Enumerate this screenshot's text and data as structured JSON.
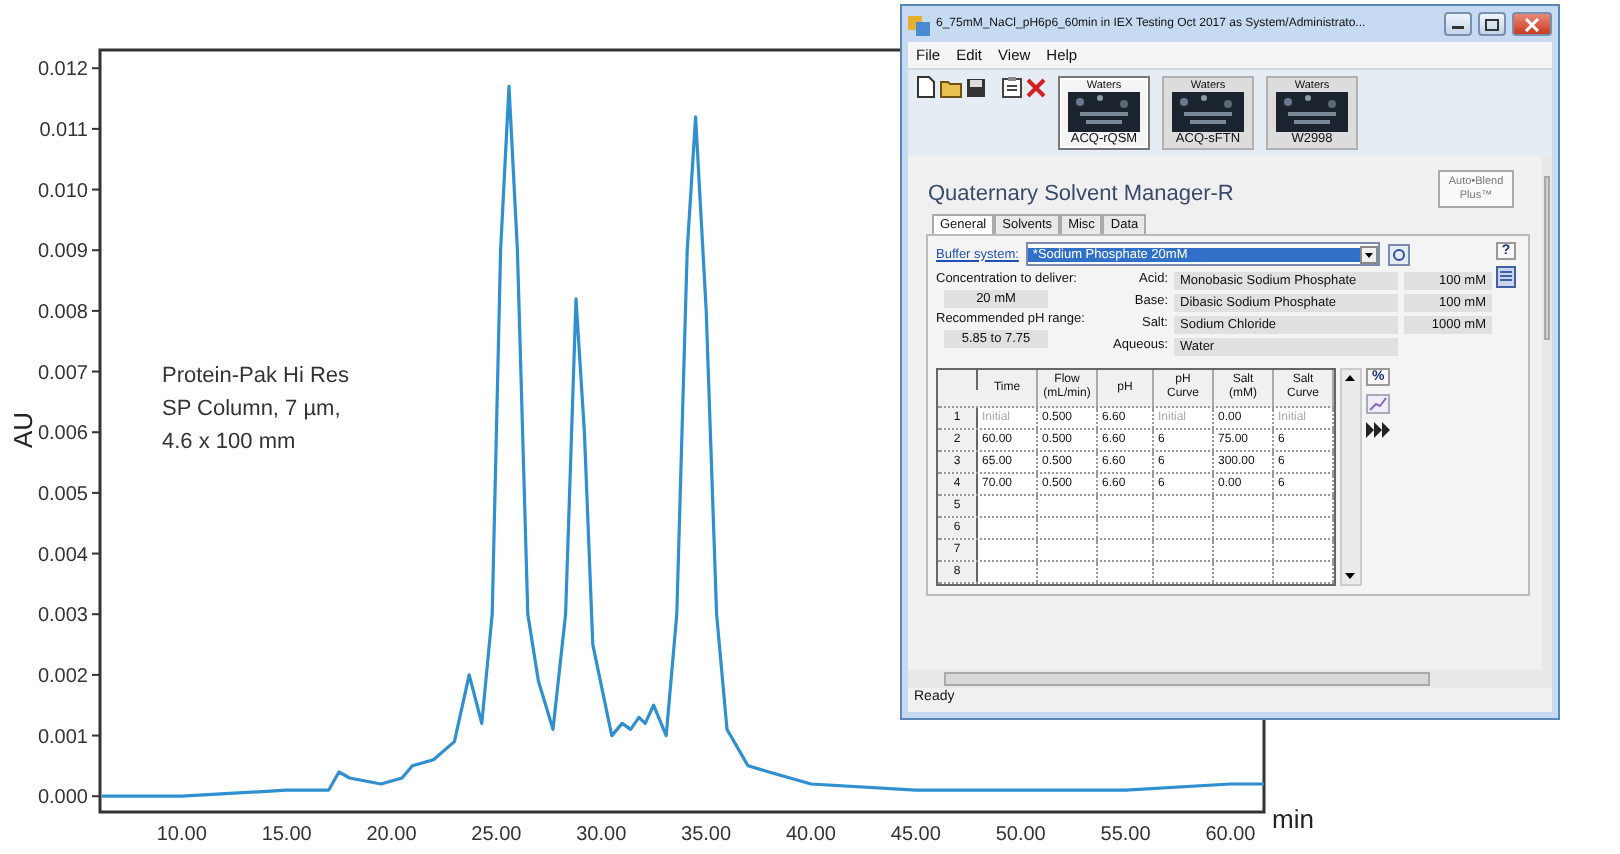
{
  "chart": {
    "chart_data": {
      "type": "line",
      "xlabel": "min",
      "ylabel": "AU",
      "x": [
        6.2,
        10,
        15,
        17,
        17.5,
        18,
        19.5,
        20.5,
        21,
        22,
        23,
        23.7,
        24.3,
        24.8,
        25.2,
        25.6,
        26,
        26.5,
        27,
        27.7,
        28.3,
        28.8,
        29.2,
        29.6,
        30.5,
        31,
        31.4,
        31.8,
        32.1,
        32.5,
        33.1,
        33.6,
        34.1,
        34.5,
        35,
        35.5,
        36,
        37,
        38,
        40,
        45,
        50,
        55,
        60,
        61.6
      ],
      "values": [
        0,
        0,
        0.0001,
        0.0001,
        0.0004,
        0.0003,
        0.0002,
        0.0003,
        0.0005,
        0.0006,
        0.0009,
        0.002,
        0.0012,
        0.003,
        0.009,
        0.0117,
        0.009,
        0.003,
        0.0019,
        0.0011,
        0.003,
        0.0082,
        0.006,
        0.0025,
        0.001,
        0.0012,
        0.0011,
        0.0013,
        0.0012,
        0.0015,
        0.001,
        0.003,
        0.009,
        0.0112,
        0.008,
        0.003,
        0.0011,
        0.0005,
        0.0004,
        0.0002,
        0.0001,
        0.0001,
        0.0001,
        0.0002,
        0.0002
      ],
      "xlim": [
        6.1,
        61.6
      ],
      "ylim": [
        -0.00026,
        0.0123
      ],
      "xticks": [
        {
          "value": 10,
          "label": "10.00"
        },
        {
          "value": 15,
          "label": "15.00"
        },
        {
          "value": 20,
          "label": "20.00"
        },
        {
          "value": 25,
          "label": "25.00"
        },
        {
          "value": 30,
          "label": "30.00"
        },
        {
          "value": 35,
          "label": "35.00"
        },
        {
          "value": 40,
          "label": "40.00"
        },
        {
          "value": 45,
          "label": "45.00"
        },
        {
          "value": 50,
          "label": "50.00"
        },
        {
          "value": 55,
          "label": "55.00"
        },
        {
          "value": 60,
          "label": "60.00"
        }
      ],
      "yticks": [
        {
          "value": 0,
          "label": "0.000"
        },
        {
          "value": 0.001,
          "label": "0.001"
        },
        {
          "value": 0.002,
          "label": "0.002"
        },
        {
          "value": 0.003,
          "label": "0.003"
        },
        {
          "value": 0.004,
          "label": "0.004"
        },
        {
          "value": 0.005,
          "label": "0.005"
        },
        {
          "value": 0.006,
          "label": "0.006"
        },
        {
          "value": 0.007,
          "label": "0.007"
        },
        {
          "value": 0.008,
          "label": "0.008"
        },
        {
          "value": 0.009,
          "label": "0.009"
        },
        {
          "value": 0.01,
          "label": "0.010"
        },
        {
          "value": 0.011,
          "label": "0.011"
        },
        {
          "value": 0.012,
          "label": "0.012"
        }
      ],
      "annotations": [
        "Protein-Pak Hi Res",
        "SP Column, 7 µm,",
        "4.6 x 100 mm"
      ]
    }
  },
  "window": {
    "title": "6_75mM_NaCl_pH6p6_60min in IEX Testing Oct 2017 as System/Administrato...",
    "menu": [
      "File",
      "Edit",
      "View",
      "Help"
    ],
    "modules": [
      {
        "brand": "Waters",
        "label": "ACQ-rQSM",
        "selected": true
      },
      {
        "brand": "Waters",
        "label": "ACQ-sFTN",
        "selected": false
      },
      {
        "brand": "Waters",
        "label": "W2998",
        "selected": false
      }
    ],
    "panel": {
      "title": "Quaternary Solvent Manager-R",
      "auto_blend_button": "Auto•Blend Plus™",
      "tabs": [
        {
          "label": "General",
          "selected": true
        },
        {
          "label": "Solvents",
          "selected": false
        },
        {
          "label": "Misc",
          "selected": false
        },
        {
          "label": "Data",
          "selected": false
        }
      ],
      "buffer_label": "Buffer system:",
      "buffer_value": "*Sodium Phosphate 20mM",
      "help_button": "?",
      "concentration_label": "Concentration to deliver:",
      "concentration_value": "20 mM",
      "ph_range_label": "Recommended pH range:",
      "ph_range_value": "5.85 to 7.75",
      "components": [
        {
          "label": "Acid:",
          "name": "Monobasic Sodium Phosphate",
          "amount": "100 mM"
        },
        {
          "label": "Base:",
          "name": "Dibasic Sodium Phosphate",
          "amount": "100 mM"
        },
        {
          "label": "Salt:",
          "name": "Sodium Chloride",
          "amount": "1000 mM"
        },
        {
          "label": "Aqueous:",
          "name": "Water"
        }
      ],
      "table": {
        "columns": [
          "Time",
          "Flow (mL/min)",
          "pH",
          "pH Curve",
          "Salt (mM)",
          "Salt Curve"
        ],
        "rows": [
          {
            "number": "1",
            "cells": [
              {
                "text": "Initial",
                "disabled": true
              },
              {
                "text": "0.500",
                "disabled": false
              },
              {
                "text": "6.60",
                "disabled": false
              },
              {
                "text": "Initial",
                "disabled": true
              },
              {
                "text": "0.00",
                "disabled": false
              },
              {
                "text": "Initial",
                "disabled": true
              }
            ]
          },
          {
            "number": "2",
            "cells": [
              {
                "text": "60.00",
                "disabled": false
              },
              {
                "text": "0.500",
                "disabled": false
              },
              {
                "text": "6.60",
                "disabled": false
              },
              {
                "text": "6",
                "disabled": false
              },
              {
                "text": "75.00",
                "disabled": false
              },
              {
                "text": "6",
                "disabled": false
              }
            ]
          },
          {
            "number": "3",
            "cells": [
              {
                "text": "65.00",
                "disabled": false
              },
              {
                "text": "0.500",
                "disabled": false
              },
              {
                "text": "6.60",
                "disabled": false
              },
              {
                "text": "6",
                "disabled": false
              },
              {
                "text": "300.00",
                "disabled": false
              },
              {
                "text": "6",
                "disabled": false
              }
            ]
          },
          {
            "number": "4",
            "cells": [
              {
                "text": "70.00",
                "disabled": false
              },
              {
                "text": "0.500",
                "disabled": false
              },
              {
                "text": "6.60",
                "disabled": false
              },
              {
                "text": "6",
                "disabled": false
              },
              {
                "text": "0.00",
                "disabled": false
              },
              {
                "text": "6",
                "disabled": false
              }
            ]
          },
          {
            "number": "5"
          },
          {
            "number": "6"
          },
          {
            "number": "7"
          },
          {
            "number": "8"
          }
        ]
      },
      "percent_button": "%"
    },
    "status_bar": "Ready"
  }
}
